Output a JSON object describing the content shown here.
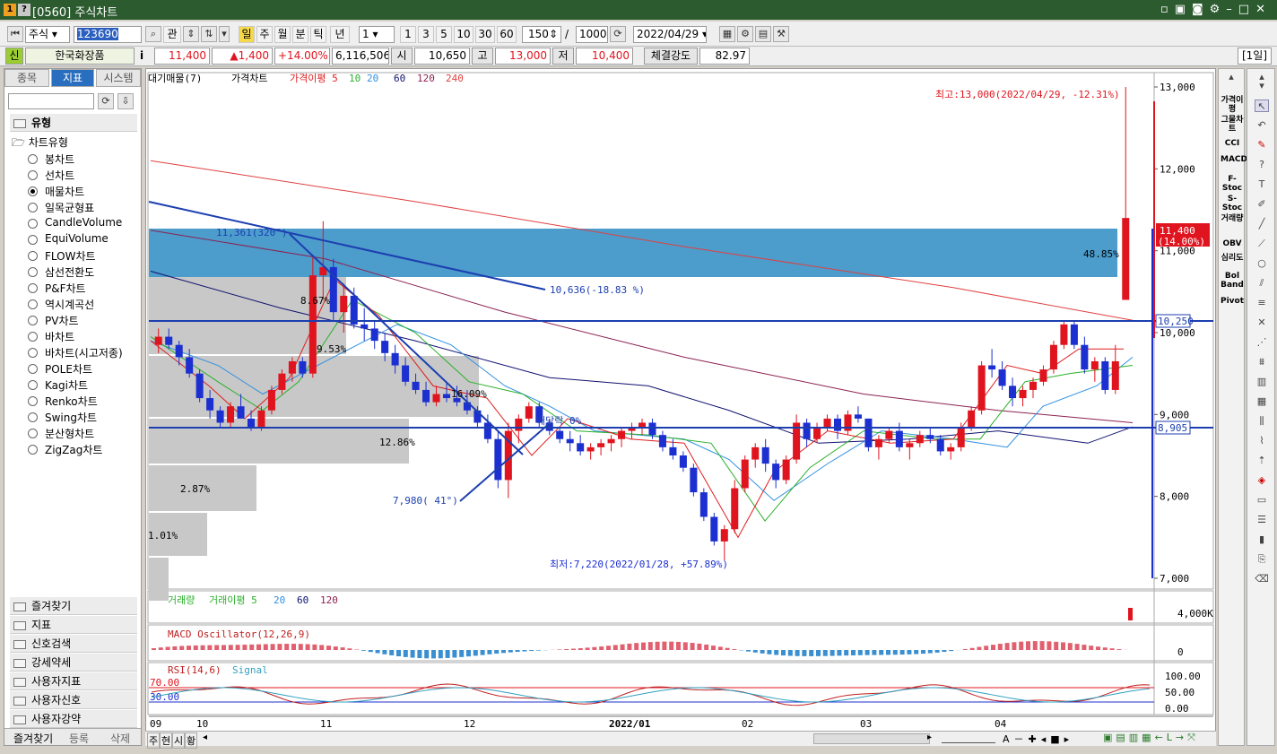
{
  "window": {
    "title": "[0560] 주식차트",
    "icons": [
      "1",
      "?"
    ]
  },
  "toolbar": {
    "market": "주식",
    "code": "123690",
    "btn_gwan": "관",
    "periods": [
      "일",
      "주",
      "월",
      "분",
      "틱",
      "년"
    ],
    "interval": "1",
    "quick": [
      "1",
      "3",
      "5",
      "10",
      "30",
      "60"
    ],
    "count": "150",
    "slash": "/",
    "total": "1000",
    "date": "2022/04/29"
  },
  "quote": {
    "badge": "신",
    "name": "한국화장품",
    "info": "i",
    "price": "11,400",
    "change": "▲1,400",
    "rate": "+14.00%",
    "volume": "6,116,506",
    "open_label": "시",
    "open": "10,650",
    "high_label": "고",
    "high": "13,000",
    "low_label": "저",
    "low": "10,400",
    "strength_label": "체결강도",
    "strength": "82.97",
    "period_tag": "[1일]"
  },
  "left": {
    "tabs": [
      "종목",
      "지표",
      "시스템"
    ],
    "section": "유형",
    "group": "차트유형",
    "types": [
      "봉차트",
      "선차트",
      "매물차트",
      "일목균형표",
      "CandleVolume",
      "EquiVolume",
      "FLOW차트",
      "삼선전환도",
      "P&F차트",
      "역시계곡선",
      "PV차트",
      "바차트",
      "바차트(시고저종)",
      "POLE차트",
      "Kagi차트",
      "Renko차트",
      "Swing차트",
      "분산형차트",
      "ZigZag차트"
    ],
    "selected_index": 2,
    "folders": [
      "즐겨찾기",
      "지표",
      "신호검색",
      "강세약세",
      "사용자지표",
      "사용자신호",
      "사용자강약"
    ],
    "bottom_tabs": [
      "즐겨찾기",
      "등록",
      "삭제"
    ]
  },
  "chart": {
    "price_legend": [
      "대기매물(7)",
      "가격차트",
      "가격이평 5",
      "10",
      "20",
      "60",
      "120",
      "240"
    ],
    "price_ticks": [
      "13,000",
      "12,000",
      "11,000",
      "10,000",
      "9,000",
      "8,000",
      "7,000"
    ],
    "high_note": "최고:13,000(2022/04/29, -12.31%)",
    "low_note": "최저:7,220(2022/01/28, +57.89%)",
    "current_price": "11,400",
    "current_rate": "(14.00%)",
    "hline1": "10,250",
    "hline2": "8,905",
    "trend_note1": "11,361(320°)",
    "trend_note2": "10,636(-18.83 %)",
    "trend_note3": "7,980( 41°)",
    "other_notes": [
      "배당락 0%",
      "9.53%",
      "16.09%",
      "12.86%",
      "2.87%",
      "1.01%",
      "48.85%",
      "8.67%"
    ],
    "vol_legend": [
      "거래량",
      "거래이평 5",
      "20",
      "60",
      "120"
    ],
    "vol_tick": "4,000K",
    "macd_legend": "MACD Oscillator(12,26,9)",
    "macd_tick": "0",
    "rsi_legend": [
      "RSI(14,6)",
      "Signal"
    ],
    "rsi_ticks": [
      "100.00",
      "50.00",
      "0.00"
    ],
    "rsi_lines": [
      "70.00",
      "30.00"
    ],
    "x_labels": [
      "09",
      "10",
      "11",
      "12",
      "2022/01",
      "02",
      "03",
      "04"
    ],
    "bottom_btns": [
      "주",
      "현",
      "시",
      "황"
    ]
  },
  "right": {
    "indicators": [
      "가격이평",
      "그물차트",
      "CCI",
      "MACD",
      "F-Stoc",
      "S-Stoc",
      "거래량",
      "OBV",
      "심리도",
      "Bol Band",
      "Pivot"
    ]
  },
  "colors": {
    "up": "#e0141e",
    "down": "#1c2fd0",
    "title_bg": "#2b5b2f",
    "tab_on": "#2a6fbf",
    "band": "#4297c9"
  },
  "chart_data": {
    "type": "candlestick",
    "ylim": [
      7000,
      13000
    ],
    "candles": [
      [
        9850,
        10050,
        9750,
        9950
      ],
      [
        9950,
        10050,
        9800,
        9850
      ],
      [
        9850,
        9900,
        9600,
        9700
      ],
      [
        9700,
        9800,
        9450,
        9500
      ],
      [
        9500,
        9550,
        9150,
        9200
      ],
      [
        9200,
        9300,
        8950,
        9050
      ],
      [
        9050,
        9100,
        8850,
        8900
      ],
      [
        8900,
        9150,
        8850,
        9100
      ],
      [
        9100,
        9250,
        8950,
        8950
      ],
      [
        8950,
        9050,
        8800,
        8850
      ],
      [
        8850,
        9100,
        8800,
        9050
      ],
      [
        9050,
        9350,
        9000,
        9300
      ],
      [
        9300,
        9550,
        9250,
        9500
      ],
      [
        9500,
        9700,
        9400,
        9650
      ],
      [
        9650,
        9700,
        9450,
        9500
      ],
      [
        9500,
        10950,
        9450,
        10700
      ],
      [
        10700,
        11361,
        10400,
        10800
      ],
      [
        10800,
        10900,
        10150,
        10250
      ],
      [
        10250,
        10600,
        10000,
        10450
      ],
      [
        10450,
        10550,
        10050,
        10100
      ],
      [
        10100,
        10300,
        9900,
        10050
      ],
      [
        10050,
        10150,
        9800,
        9900
      ],
      [
        9900,
        10000,
        9650,
        9750
      ],
      [
        9750,
        9850,
        9500,
        9600
      ],
      [
        9600,
        9700,
        9350,
        9400
      ],
      [
        9400,
        9500,
        9250,
        9300
      ],
      [
        9300,
        9400,
        9100,
        9150
      ],
      [
        9150,
        9350,
        9100,
        9250
      ],
      [
        9250,
        9400,
        9150,
        9200
      ],
      [
        9200,
        9350,
        9100,
        9150
      ],
      [
        9150,
        9300,
        9000,
        9050
      ],
      [
        9050,
        9100,
        8850,
        8900
      ],
      [
        8900,
        9000,
        8650,
        8700
      ],
      [
        8700,
        8800,
        8100,
        8200
      ],
      [
        8200,
        8900,
        7980,
        8800
      ],
      [
        8800,
        9000,
        8650,
        8950
      ],
      [
        8950,
        9150,
        8900,
        9100
      ],
      [
        9100,
        9150,
        8850,
        8900
      ],
      [
        8900,
        8950,
        8750,
        8800
      ],
      [
        8800,
        8850,
        8650,
        8700
      ],
      [
        8700,
        8800,
        8550,
        8650
      ],
      [
        8650,
        8750,
        8500,
        8550
      ],
      [
        8550,
        8650,
        8450,
        8600
      ],
      [
        8600,
        8700,
        8500,
        8650
      ],
      [
        8650,
        8750,
        8550,
        8700
      ],
      [
        8700,
        8850,
        8600,
        8800
      ],
      [
        8800,
        8900,
        8700,
        8850
      ],
      [
        8850,
        8950,
        8750,
        8900
      ],
      [
        8900,
        8950,
        8700,
        8750
      ],
      [
        8750,
        8800,
        8550,
        8600
      ],
      [
        8600,
        8700,
        8450,
        8500
      ],
      [
        8500,
        8550,
        8300,
        8350
      ],
      [
        8350,
        8400,
        8000,
        8050
      ],
      [
        8050,
        8100,
        7700,
        7750
      ],
      [
        7750,
        7800,
        7400,
        7450
      ],
      [
        7450,
        7650,
        7220,
        7600
      ],
      [
        7600,
        8200,
        7550,
        8100
      ],
      [
        8100,
        8500,
        8050,
        8450
      ],
      [
        8450,
        8650,
        8350,
        8600
      ],
      [
        8600,
        8700,
        8300,
        8400
      ],
      [
        8400,
        8450,
        8100,
        8200
      ],
      [
        8200,
        8500,
        8150,
        8450
      ],
      [
        8450,
        9000,
        8400,
        8900
      ],
      [
        8900,
        8950,
        8600,
        8700
      ],
      [
        8700,
        8900,
        8650,
        8850
      ],
      [
        8850,
        9000,
        8800,
        8950
      ],
      [
        8950,
        9000,
        8700,
        8800
      ],
      [
        8800,
        9050,
        8750,
        9000
      ],
      [
        9000,
        9100,
        8900,
        8950
      ],
      [
        8950,
        8950,
        8550,
        8600
      ],
      [
        8600,
        8750,
        8450,
        8700
      ],
      [
        8700,
        8850,
        8650,
        8800
      ],
      [
        8800,
        8900,
        8550,
        8600
      ],
      [
        8600,
        8700,
        8450,
        8650
      ],
      [
        8650,
        8800,
        8600,
        8750
      ],
      [
        8750,
        8850,
        8650,
        8700
      ],
      [
        8700,
        8750,
        8500,
        8550
      ],
      [
        8550,
        8650,
        8450,
        8600
      ],
      [
        8600,
        8900,
        8550,
        8850
      ],
      [
        8850,
        9100,
        8800,
        9050
      ],
      [
        9050,
        9650,
        9000,
        9600
      ],
      [
        9600,
        9800,
        9450,
        9550
      ],
      [
        9550,
        9650,
        9300,
        9350
      ],
      [
        9350,
        9450,
        9100,
        9200
      ],
      [
        9200,
        9350,
        9100,
        9300
      ],
      [
        9300,
        9450,
        9200,
        9400
      ],
      [
        9400,
        9600,
        9350,
        9550
      ],
      [
        9550,
        9900,
        9500,
        9850
      ],
      [
        9850,
        10150,
        9800,
        10100
      ],
      [
        10100,
        10150,
        9800,
        9850
      ],
      [
        9850,
        9950,
        9500,
        9550
      ],
      [
        9550,
        9700,
        9400,
        9650
      ],
      [
        9650,
        9700,
        9250,
        9300
      ],
      [
        9300,
        9850,
        9250,
        9650
      ],
      [
        10400,
        13000,
        10400,
        11400
      ]
    ],
    "series": [
      {
        "name": "가격이평 5"
      },
      {
        "name": "10"
      },
      {
        "name": "20"
      },
      {
        "name": "60"
      },
      {
        "name": "120"
      },
      {
        "name": "240"
      }
    ]
  }
}
